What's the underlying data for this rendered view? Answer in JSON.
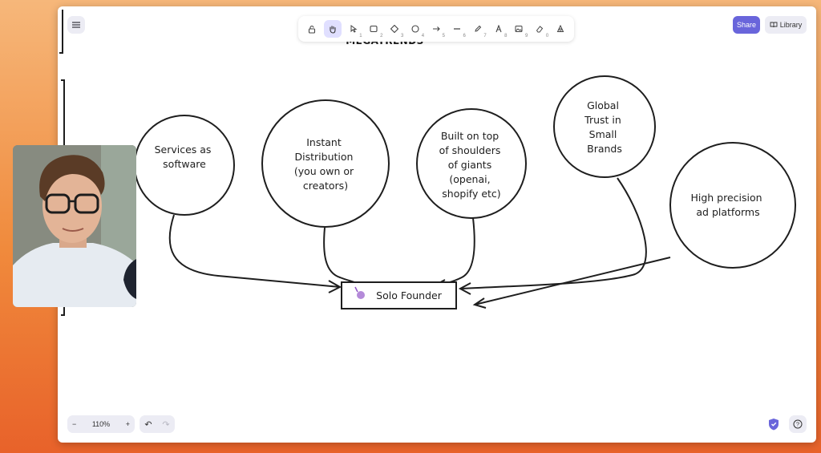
{
  "toolbar": {
    "tools": [
      {
        "name": "lock-icon",
        "key": ""
      },
      {
        "name": "hand-icon",
        "key": ""
      },
      {
        "name": "selection-icon",
        "key": "1"
      },
      {
        "name": "rectangle-icon",
        "key": "2"
      },
      {
        "name": "diamond-icon",
        "key": "3"
      },
      {
        "name": "ellipse-icon",
        "key": "4"
      },
      {
        "name": "arrow-icon",
        "key": "5"
      },
      {
        "name": "line-icon",
        "key": "6"
      },
      {
        "name": "pencil-icon",
        "key": "7"
      },
      {
        "name": "text-icon",
        "key": "8"
      },
      {
        "name": "image-icon",
        "key": "9"
      },
      {
        "name": "eraser-icon",
        "key": "0"
      },
      {
        "name": "more-tools-icon",
        "key": ""
      }
    ]
  },
  "header": {
    "share_label": "Share",
    "library_label": "Library"
  },
  "footer": {
    "zoom_label": "110%",
    "zoom_out": "−",
    "zoom_in": "+",
    "undo": "↶",
    "redo": "↷",
    "help": "?"
  },
  "canvas": {
    "title": "MEGATRENDS",
    "nodes": {
      "services": [
        "Services as",
        "software"
      ],
      "distribution": [
        "Instant",
        "Distribution",
        "(you own or",
        "creators)"
      ],
      "shoulders": [
        "Built on top",
        "of shoulders",
        "of giants",
        "(openai,",
        "shopify etc)"
      ],
      "trust": [
        "Global",
        "Trust in",
        "Small",
        "Brands"
      ],
      "adplatforms": [
        "High precision",
        "ad platforms"
      ]
    },
    "target": "Solo Founder"
  },
  "colors": {
    "accent": "#6965db",
    "stroke": "#1e1e1e",
    "background_gradient_start": "#f6b77a",
    "background_gradient_end": "#e8622a"
  }
}
